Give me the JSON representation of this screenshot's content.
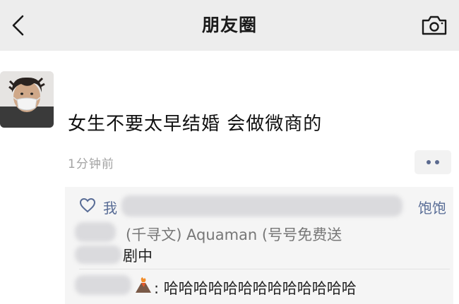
{
  "header": {
    "title": "朋友圈",
    "back_icon": "chevron-left-icon",
    "camera_icon": "camera-icon"
  },
  "post": {
    "text": "女生不要太早结婚  会做微商的",
    "time": "1分钟前",
    "more_icon": "more-dots-icon"
  },
  "likes": {
    "icon": "heart-icon",
    "prefix": "我",
    "suffix": "饱饱"
  },
  "comments": [
    {
      "text_visible": "(千寻文) Aquaman (号号免费送",
      "line2": "剧中"
    },
    {
      "emoji": "volcano-emoji",
      "text": ": 哈哈哈哈哈哈哈哈哈哈哈哈哈"
    }
  ],
  "colors": {
    "header_bg": "#ededed",
    "nickname_blue": "#576b95",
    "time_gray": "#a3a3a3",
    "interaction_bg": "#f5f5f5"
  }
}
